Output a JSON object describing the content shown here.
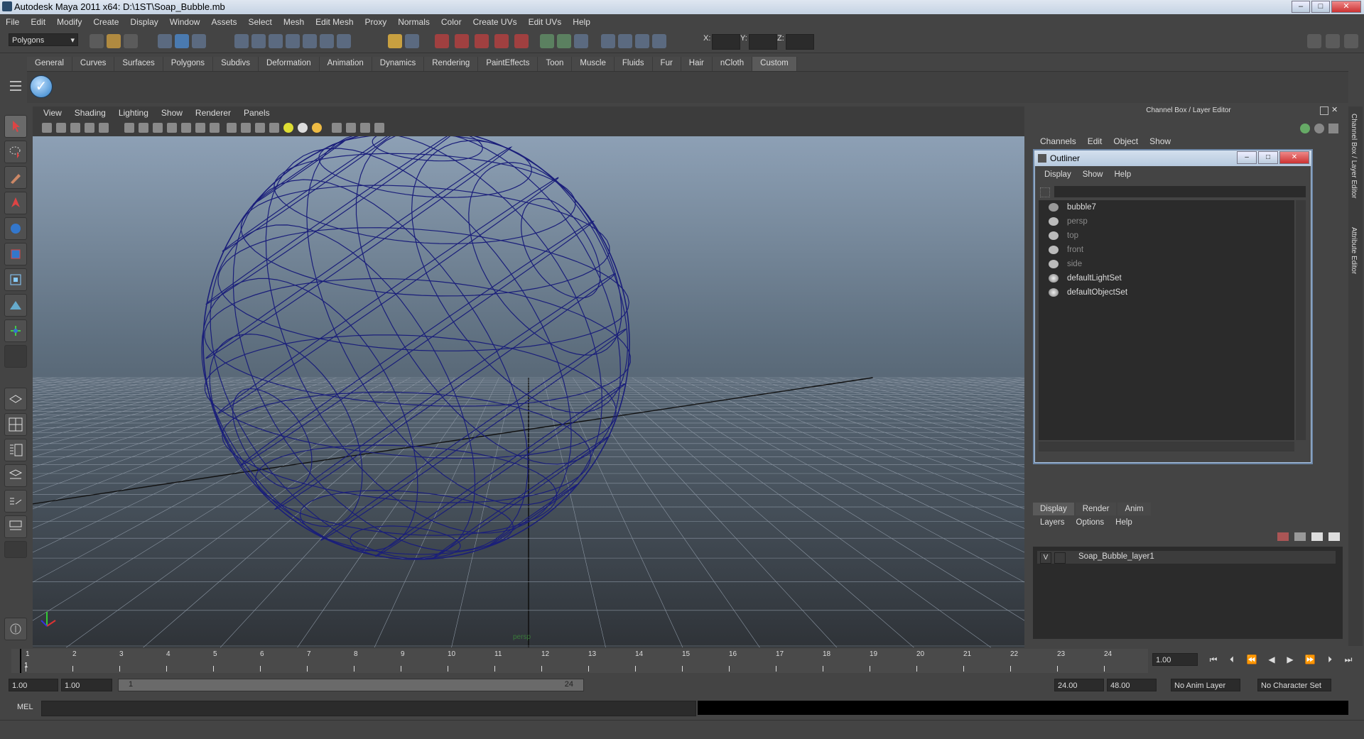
{
  "window": {
    "title": "Autodesk Maya 2011 x64: D:\\1ST\\Soap_Bubble.mb",
    "min": "–",
    "max": "□",
    "close": "✕"
  },
  "menubar": [
    "File",
    "Edit",
    "Modify",
    "Create",
    "Display",
    "Window",
    "Assets",
    "Select",
    "Mesh",
    "Edit Mesh",
    "Proxy",
    "Normals",
    "Color",
    "Create UVs",
    "Edit UVs",
    "Help"
  ],
  "status": {
    "mode": "Polygons",
    "x_label": "X:",
    "y_label": "Y:",
    "z_label": "Z:"
  },
  "shelf": {
    "tabs": [
      "General",
      "Curves",
      "Surfaces",
      "Polygons",
      "Subdivs",
      "Deformation",
      "Animation",
      "Dynamics",
      "Rendering",
      "PaintEffects",
      "Toon",
      "Muscle",
      "Fluids",
      "Fur",
      "Hair",
      "nCloth",
      "Custom"
    ],
    "active": "Custom"
  },
  "viewport": {
    "menu": [
      "View",
      "Shading",
      "Lighting",
      "Show",
      "Renderer",
      "Panels"
    ],
    "camera": "persp",
    "wire_color": "#1a1e7a"
  },
  "channel_box": {
    "title": "Channel Box / Layer Editor",
    "menu": [
      "Channels",
      "Edit",
      "Object",
      "Show"
    ]
  },
  "outliner": {
    "title": "Outliner",
    "menu": [
      "Display",
      "Show",
      "Help"
    ],
    "items": [
      {
        "label": "bubble7",
        "dim": false,
        "icon": "transform-icon"
      },
      {
        "label": "persp",
        "dim": true,
        "icon": "camera-icon"
      },
      {
        "label": "top",
        "dim": true,
        "icon": "camera-icon"
      },
      {
        "label": "front",
        "dim": true,
        "icon": "camera-icon"
      },
      {
        "label": "side",
        "dim": true,
        "icon": "camera-icon"
      },
      {
        "label": "defaultLightSet",
        "dim": false,
        "icon": "set-icon"
      },
      {
        "label": "defaultObjectSet",
        "dim": false,
        "icon": "set-icon"
      }
    ]
  },
  "layers": {
    "tabs": [
      "Display",
      "Render",
      "Anim"
    ],
    "active": "Display",
    "menu": [
      "Layers",
      "Options",
      "Help"
    ],
    "rows": [
      {
        "visible": "V",
        "name": "Soap_Bubble_layer1"
      }
    ]
  },
  "side_tabs": [
    "Channel Box / Layer Editor",
    "Attribute Editor"
  ],
  "timeline": {
    "ticks": [
      "1",
      "2",
      "3",
      "4",
      "5",
      "6",
      "7",
      "8",
      "9",
      "10",
      "11",
      "12",
      "13",
      "14",
      "15",
      "16",
      "17",
      "18",
      "19",
      "20",
      "21",
      "22",
      "23",
      "24"
    ],
    "current": "1",
    "current_field": "1.00"
  },
  "range": {
    "start": "1.00",
    "playback_start": "1.00",
    "slider_left": "1",
    "slider_right": "24",
    "playback_end": "24.00",
    "end": "48.00",
    "anim_layer": "No Anim Layer",
    "character_set": "No Character Set"
  },
  "command": {
    "label": "MEL"
  }
}
